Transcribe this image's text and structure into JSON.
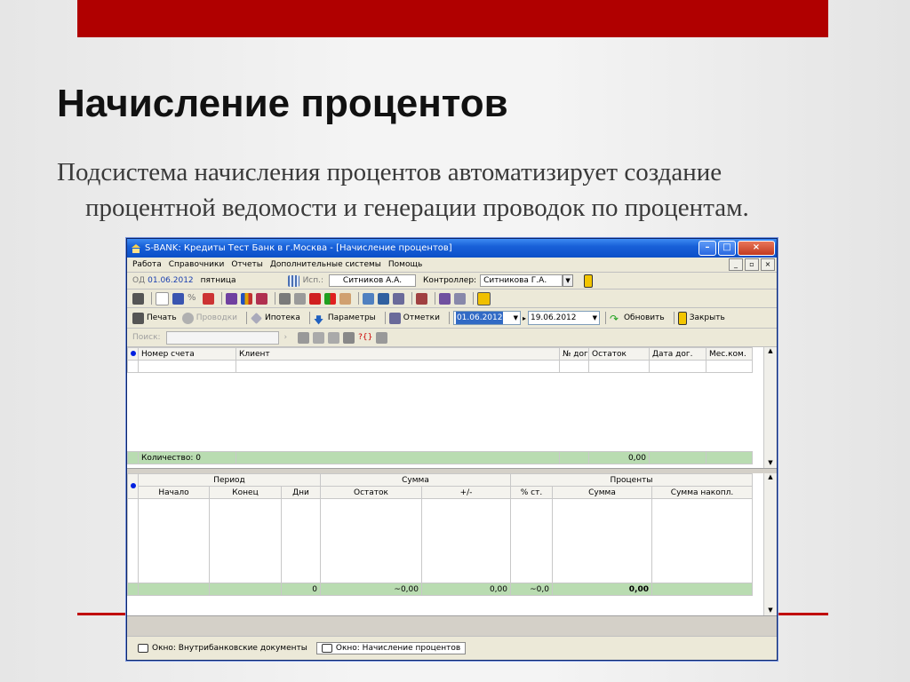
{
  "slide": {
    "title": "Начисление процентов",
    "text_line1": "Подсистема начисления процентов автоматизирует создание",
    "text_line2": "процентной ведомости и генерации проводок по процентам."
  },
  "window": {
    "title": "S-BANK: Кредиты Тест Банк в г.Москва - [Начисление процентов]",
    "controls": {
      "minimize": "–",
      "maximize": "□",
      "close": "×"
    }
  },
  "menu": [
    "Работа",
    "Справочники",
    "Отчеты",
    "Дополнительные системы",
    "Помощь"
  ],
  "mdi_controls": [
    "_",
    "▫",
    "×"
  ],
  "info": {
    "od_label": "ОД",
    "od_date": "01.06.2012",
    "weekday": "пятница",
    "isp_label": "Исп.:",
    "isp_value": "Ситников А.А.",
    "controller_label": "Контроллер:",
    "controller_value": "Ситникова Г.А."
  },
  "actions": {
    "print": "Печать",
    "postings": "Проводки",
    "mortgage": "Ипотека",
    "params": "Параметры",
    "marks": "Отметки",
    "date_from": "01.06.2012",
    "date_to": "19.06.2012",
    "refresh": "Обновить",
    "close": "Закрыть"
  },
  "search": {
    "label": "Поиск:",
    "arrow": "›",
    "help": "?{}"
  },
  "upper_grid": {
    "columns": [
      "Номер счета",
      "Клиент",
      "№ дог.",
      "Остаток",
      "Дата дог.",
      "Мес.ком."
    ],
    "summary": {
      "count": "Количество: 0",
      "amount": "0,00"
    }
  },
  "lower_grid": {
    "groups": [
      "Период",
      "Сумма",
      "Проценты"
    ],
    "columns": [
      "Начало",
      "Конец",
      "Дни",
      "Остаток",
      "+/-",
      "% ст.",
      "Сумма",
      "Сумма накопл."
    ],
    "summary": [
      "",
      "",
      "0",
      "~0,00",
      "0,00",
      "~0,0",
      "0,00",
      ""
    ]
  },
  "taskbar": {
    "items": [
      "Окно: Внутрибанковские документы",
      "Окно: Начисление процентов"
    ],
    "active_index": 1
  },
  "colors": {
    "accent_red": "#b00000",
    "title_blue": "#0b4fc8",
    "summary_green": "#b9dcb1"
  }
}
